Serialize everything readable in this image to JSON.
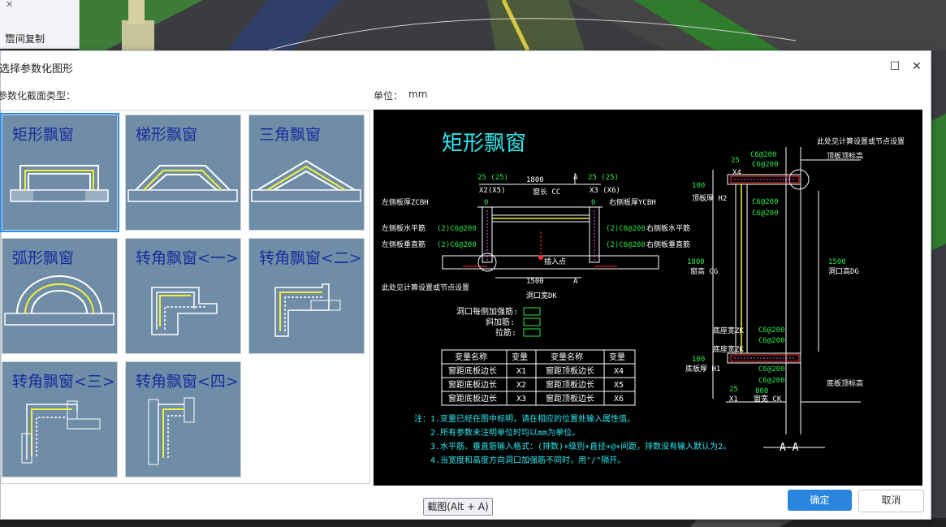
{
  "background": {
    "menu_item": "层间复制"
  },
  "dialog": {
    "title": "选择参数化图形",
    "section_label": "参数化截面类型：",
    "unit_label": "单位：",
    "unit_value": "mm",
    "ok_label": "确定",
    "cancel_label": "取消"
  },
  "tiles": [
    {
      "label": "矩形飘窗"
    },
    {
      "label": "梯形飘窗"
    },
    {
      "label": "三角飘窗"
    },
    {
      "label": "弧形飘窗"
    },
    {
      "label": "转角飘窗<一>"
    },
    {
      "label": "转角飘窗<二>"
    },
    {
      "label": "转角飘窗<三>"
    },
    {
      "label": "转角飘窗<四>"
    }
  ],
  "screenshot_button": "截图(Alt + A)",
  "preview": {
    "title": "矩形飘窗",
    "top_dims": {
      "left": "25 (25)",
      "mid": "1800",
      "right": "25 (25)",
      "a": "A",
      "x2": "X2(X5)",
      "cc": "窗长 CC",
      "x3": "X3 (X6)"
    },
    "zero_l": "0",
    "zero_r": "0",
    "left_thk": "左侧板厚ZCBH",
    "right_thk": "右侧板厚YCBH",
    "left_h": "左侧板水平筋",
    "left_h_val": "(2)C6@200",
    "left_v": "左侧板垂直筋",
    "left_v_val": "(2)C6@200",
    "right_h": "右侧板水平筋",
    "right_h_val": "(2)C6@200",
    "right_v": "右侧板垂直筋",
    "right_v_val": "(2)C6@200",
    "insert_pt": "插入点",
    "calc_note": "此处见计算设置或节点设置",
    "dk_val": "1500",
    "dk": "洞口宽DK",
    "a2": "A",
    "reinf1": "洞口每侧加强筋:",
    "reinf2": "斜加筋:",
    "reinf3": "拉筋:",
    "table": {
      "headers": [
        "变量名称",
        "变量",
        "变量名称",
        "变量"
      ],
      "rows": [
        [
          "窗距底板边长",
          "X1",
          "窗距顶板边长",
          "X4"
        ],
        [
          "窗距底板边长",
          "X2",
          "窗距顶板边长",
          "X5"
        ],
        [
          "窗距底板边长",
          "X3",
          "窗距顶板边长",
          "X6"
        ]
      ]
    },
    "notes": [
      "注：1.变量已经在图中标明，请在相应的位置处输入属性值。",
      "2.所有参数未注明单位时均以mm为单位。",
      "3.水平筋、垂直筋输入格式：(排数)+级别+直径+@+间距，排数没有输入默认为2。",
      "4.当宽度和高度方向洞口加强筋不同时，用\"/\"隔开。"
    ],
    "right": {
      "calc_note": "此处见计算设置或节点设置",
      "top_elev": "顶板顶标高",
      "d25a": "25",
      "x4": "X4",
      "c1": "C6@200",
      "c2": "C6@200",
      "d100a": "100",
      "top_h": "顶板厚 H2",
      "c3": "C6@200",
      "c4": "C6@200",
      "d1800": "1800",
      "cg": "窗高 CG",
      "d1500": "1500",
      "dg": "洞口高DG",
      "bot_out": "底座宽ZK",
      "bot_out2": "底座宽ZK",
      "c5": "C6@200",
      "c6": "C6@200",
      "d100b": "100",
      "bot_h": "底板厚 H1",
      "c7": "C6@200",
      "c8": "C6@200",
      "d25b": "25",
      "d800": "800",
      "x1": "X1",
      "ck": "窗宽 CK",
      "bot_elev": "底板顶标高",
      "section": "A-A"
    }
  }
}
